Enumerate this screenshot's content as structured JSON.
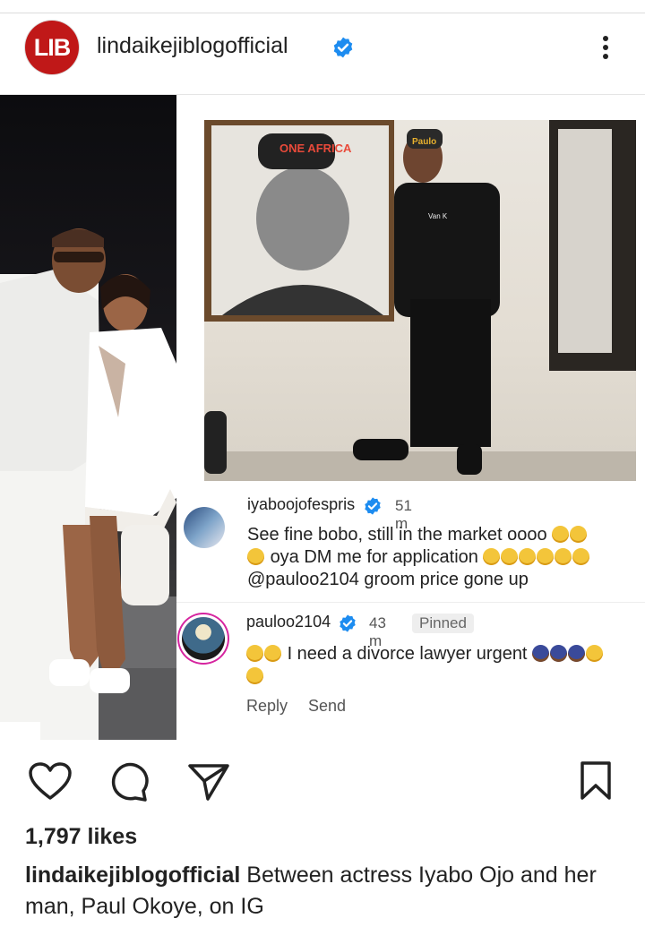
{
  "header": {
    "avatar_text": "LIB",
    "username": "lindaikejiblogofficial",
    "verified_icon": "verified-badge-icon",
    "more_icon": "more-options-icon"
  },
  "post": {
    "painting_cap_text": "ONE AFRICA",
    "cap_text": "Paulo",
    "shirt_text": "Van K"
  },
  "comments": [
    {
      "username": "iyaboojofespris",
      "verified": true,
      "time": "51 m",
      "line1": "See fine bobo, still in the market oooo",
      "line2": "oya  DM me for application",
      "line3": "@pauloo2104 groom price gone up"
    },
    {
      "username": "pauloo2104",
      "verified": true,
      "time": "43 m",
      "badge": "Pinned",
      "text": "I need a divorce lawyer urgent",
      "reply": "Reply",
      "send": "Send"
    }
  ],
  "actions": {
    "like_icon": "heart-icon",
    "comment_icon": "comment-icon",
    "share_icon": "send-icon",
    "save_icon": "bookmark-icon"
  },
  "likes": "1,797 likes",
  "caption": {
    "username": "lindaikejiblogofficial",
    "text": "Between actress Iyabo Ojo and her man, Paul Okoye, on IG"
  },
  "colors": {
    "brand_red": "#c01818",
    "verified_blue": "#1d8cf0"
  }
}
